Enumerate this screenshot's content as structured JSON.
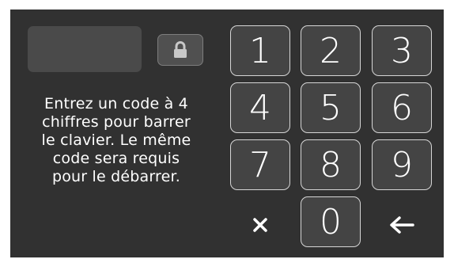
{
  "instructions": {
    "line1": "Entrez un code à 4",
    "line2": "chiffres pour barrer",
    "line3": "le clavier. Le même",
    "line4": "code sera requis",
    "line5": "pour le débarrer."
  },
  "lock_button": {
    "icon": "lock-icon"
  },
  "keypad": {
    "key1": "1",
    "key2": "2",
    "key3": "3",
    "key4": "4",
    "key5": "5",
    "key6": "6",
    "key7": "7",
    "key8": "8",
    "key9": "9",
    "key0": "0",
    "clear_icon": "close-icon",
    "back_icon": "arrow-left-icon"
  },
  "colors": {
    "background": "#313131",
    "key_fill": "#444444",
    "key_border": "#d6d6d6",
    "display_fill": "#4a4a4a",
    "text": "#ffffff"
  }
}
